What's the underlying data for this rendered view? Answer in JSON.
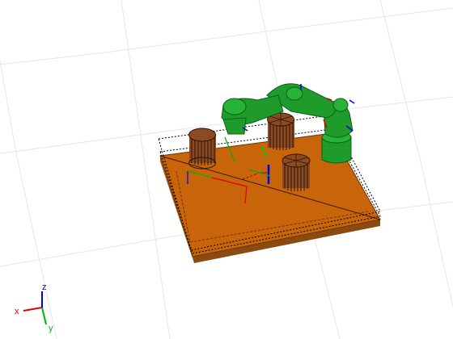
{
  "scene": {
    "background": "#ffffff",
    "grid_color": "#e6e6e6",
    "table_color": "#c8640a",
    "table_shadow": "#8a4a10",
    "robot_color": "#1e9b2a",
    "robot_dark": "#0d5f17",
    "cylinder_color": "#8b4a22",
    "cylinder_dark": "#2b1408",
    "frame_x_color": "#e00000",
    "frame_y_color": "#00b400",
    "frame_z_color": "#0000e6"
  },
  "axes_triad": {
    "x_label": "x",
    "y_label": "y",
    "z_label": "z"
  }
}
